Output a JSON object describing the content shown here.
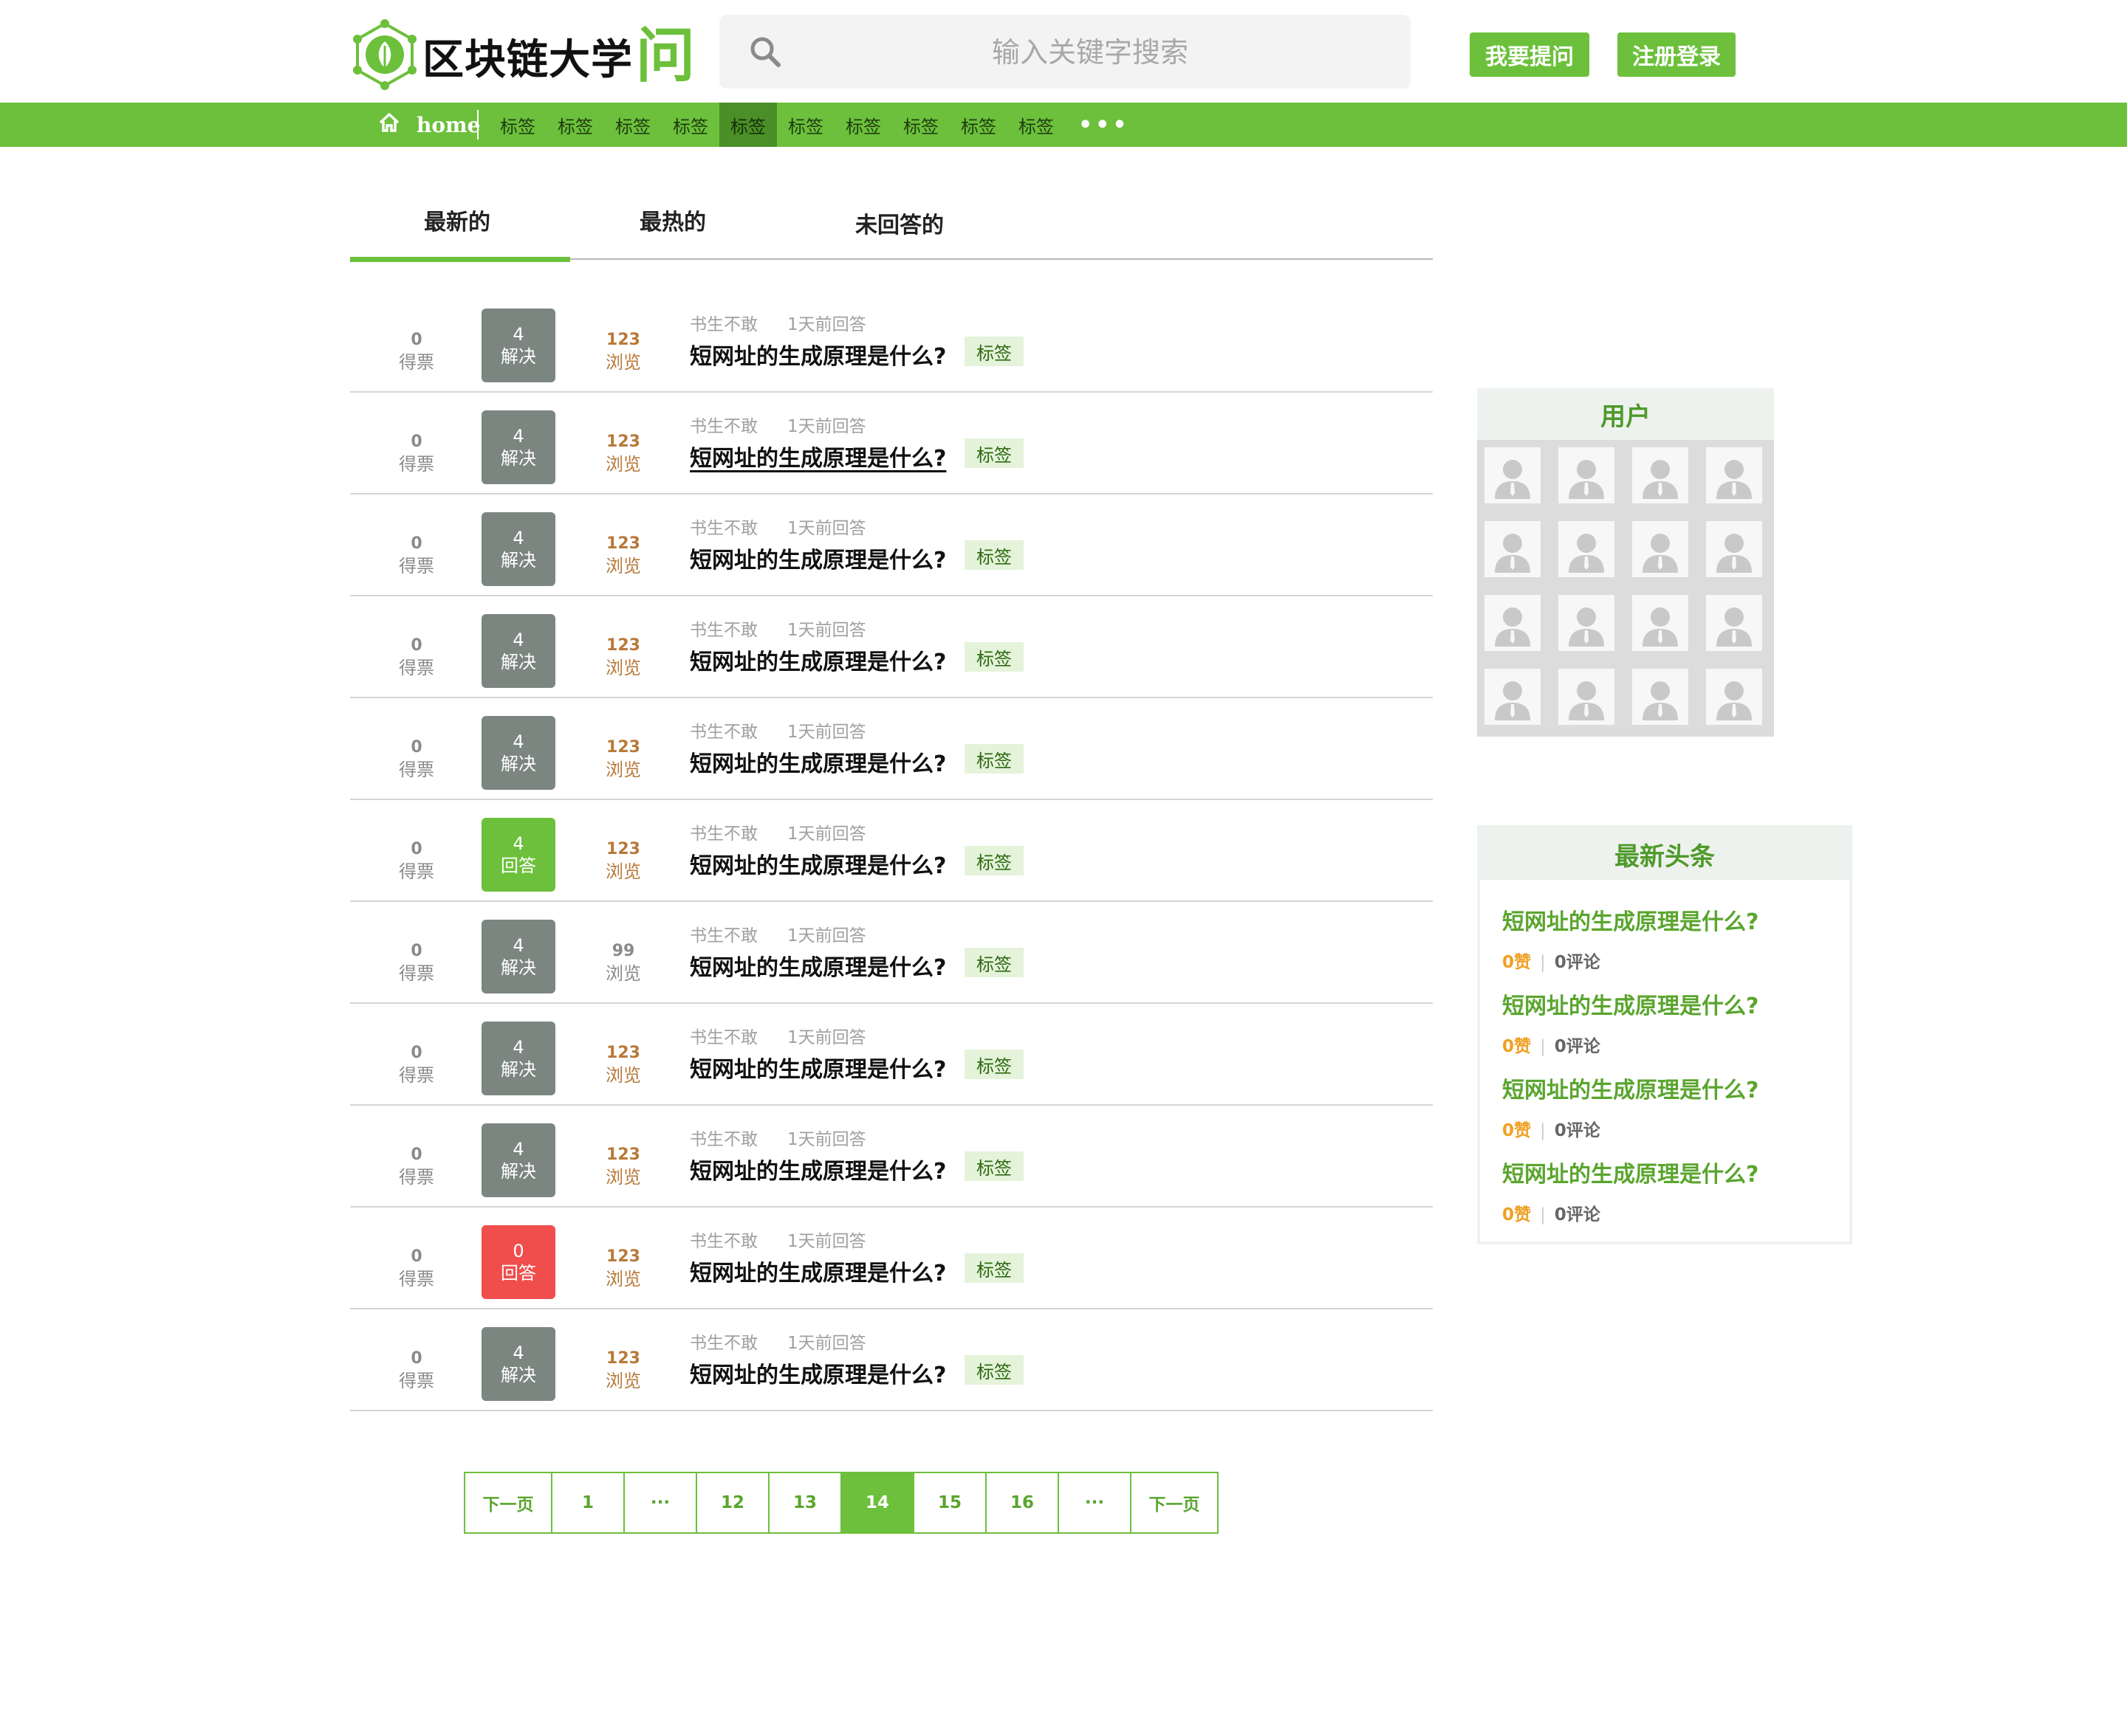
{
  "header": {
    "logo_text": "区块链大学",
    "logo_big_char": "问",
    "search_placeholder": "输入关键字搜索",
    "ask_button": "我要提问",
    "login_button": "注册登录"
  },
  "nav": {
    "home_label": "home",
    "tags": [
      "标签",
      "标签",
      "标签",
      "标签",
      "标签",
      "标签",
      "标签",
      "标签",
      "标签",
      "标签"
    ],
    "active_tag_index": 4,
    "more": "•••"
  },
  "tabs": [
    "最新的",
    "最热的",
    "未回答的"
  ],
  "questions": [
    {
      "votes": "0",
      "votes_label": "得票",
      "answers": "4",
      "answers_label": "解决",
      "status": "gray",
      "views": "123",
      "views_label": "浏览",
      "author": "书生不敢",
      "time": "1天前回答",
      "title": "短网址的生成原理是什么?",
      "tag": "标签"
    },
    {
      "votes": "0",
      "votes_label": "得票",
      "answers": "4",
      "answers_label": "解决",
      "status": "gray",
      "views": "123",
      "views_label": "浏览",
      "author": "书生不敢",
      "time": "1天前回答",
      "title": "短网址的生成原理是什么?",
      "tag": "标签"
    },
    {
      "votes": "0",
      "votes_label": "得票",
      "answers": "4",
      "answers_label": "解决",
      "status": "gray",
      "views": "123",
      "views_label": "浏览",
      "author": "书生不敢",
      "time": "1天前回答",
      "title": "短网址的生成原理是什么?",
      "tag": "标签"
    },
    {
      "votes": "0",
      "votes_label": "得票",
      "answers": "4",
      "answers_label": "解决",
      "status": "gray",
      "views": "123",
      "views_label": "浏览",
      "author": "书生不敢",
      "time": "1天前回答",
      "title": "短网址的生成原理是什么?",
      "tag": "标签"
    },
    {
      "votes": "0",
      "votes_label": "得票",
      "answers": "4",
      "answers_label": "解决",
      "status": "gray",
      "views": "123",
      "views_label": "浏览",
      "author": "书生不敢",
      "time": "1天前回答",
      "title": "短网址的生成原理是什么?",
      "tag": "标签"
    },
    {
      "votes": "0",
      "votes_label": "得票",
      "answers": "4",
      "answers_label": "回答",
      "status": "green",
      "views": "123",
      "views_label": "浏览",
      "author": "书生不敢",
      "time": "1天前回答",
      "title": "短网址的生成原理是什么?",
      "tag": "标签"
    },
    {
      "votes": "0",
      "votes_label": "得票",
      "answers": "4",
      "answers_label": "解决",
      "status": "gray",
      "views": "99",
      "views_label": "浏览",
      "author": "书生不敢",
      "time": "1天前回答",
      "title": "短网址的生成原理是什么?",
      "tag": "标签"
    },
    {
      "votes": "0",
      "votes_label": "得票",
      "answers": "4",
      "answers_label": "解决",
      "status": "gray",
      "views": "123",
      "views_label": "浏览",
      "author": "书生不敢",
      "time": "1天前回答",
      "title": "短网址的生成原理是什么?",
      "tag": "标签"
    },
    {
      "votes": "0",
      "votes_label": "得票",
      "answers": "4",
      "answers_label": "解决",
      "status": "gray",
      "views": "123",
      "views_label": "浏览",
      "author": "书生不敢",
      "time": "1天前回答",
      "title": "短网址的生成原理是什么?",
      "tag": "标签"
    },
    {
      "votes": "0",
      "votes_label": "得票",
      "answers": "0",
      "answers_label": "回答",
      "status": "red",
      "views": "123",
      "views_label": "浏览",
      "author": "书生不敢",
      "time": "1天前回答",
      "title": "短网址的生成原理是什么?",
      "tag": "标签"
    },
    {
      "votes": "0",
      "votes_label": "得票",
      "answers": "4",
      "answers_label": "解决",
      "status": "gray",
      "views": "123",
      "views_label": "浏览",
      "author": "书生不敢",
      "time": "1天前回答",
      "title": "短网址的生成原理是什么?",
      "tag": "标签"
    }
  ],
  "pagination": [
    "下一页",
    "1",
    "···",
    "12",
    "13",
    "14",
    "15",
    "16",
    "···",
    "下一页"
  ],
  "pagination_active_index": 5,
  "sidebar": {
    "users_title": "用户",
    "user_count": 16,
    "news_title": "最新头条",
    "news": [
      {
        "title": "短网址的生成原理是什么?",
        "likes": "0赞",
        "comments": "0评论"
      },
      {
        "title": "短网址的生成原理是什么?",
        "likes": "0赞",
        "comments": "0评论"
      },
      {
        "title": "短网址的生成原理是什么?",
        "likes": "0赞",
        "comments": "0评论"
      },
      {
        "title": "短网址的生成原理是什么?",
        "likes": "0赞",
        "comments": "0评论"
      }
    ]
  },
  "colors": {
    "brand_green": "#6cc03b",
    "active_tag": "#4a8f27",
    "answered_gray": "#7c8681",
    "unanswered_red": "#f04d4d",
    "views_orange": "#b8793a",
    "likes_orange": "#f0a022"
  }
}
